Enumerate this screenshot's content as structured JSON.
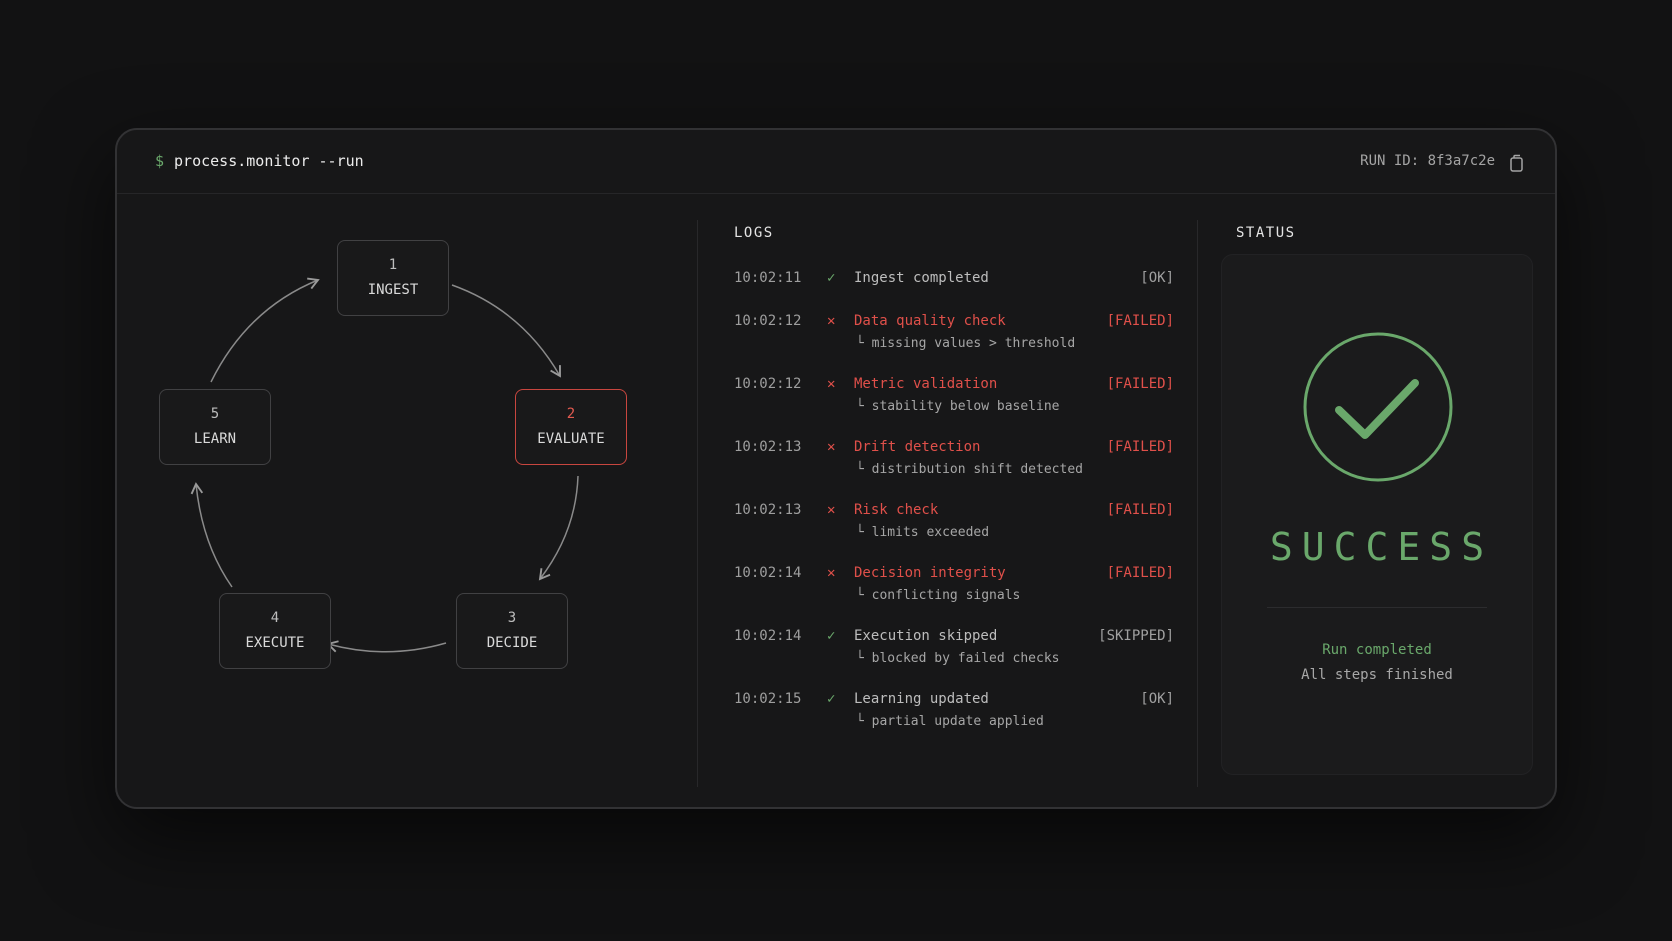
{
  "header": {
    "prompt_symbol": "$",
    "command": "process.monitor --run",
    "run_id": "RUN ID: 8f3a7c2e",
    "copy_icon": "copy-icon"
  },
  "flow": {
    "steps": [
      {
        "number": "1",
        "label": "INGEST",
        "active": false
      },
      {
        "number": "2",
        "label": "EVALUATE",
        "active": true
      },
      {
        "number": "3",
        "label": "DECIDE",
        "active": false
      },
      {
        "number": "4",
        "label": "EXECUTE",
        "active": false
      },
      {
        "number": "5",
        "label": "LEARN",
        "active": false
      }
    ]
  },
  "logs": {
    "title": "LOGS",
    "entries": [
      {
        "time": "10:02:11",
        "status": "ok",
        "icon": "check-icon",
        "message": "Ingest completed",
        "tag": "[OK]",
        "detail": ""
      },
      {
        "time": "10:02:12",
        "status": "fail",
        "icon": "x-icon",
        "message": "Data quality check",
        "tag": "[FAILED]",
        "detail": "└ missing values > threshold"
      },
      {
        "time": "10:02:12",
        "status": "fail",
        "icon": "x-icon",
        "message": "Metric validation",
        "tag": "[FAILED]",
        "detail": "└ stability below baseline"
      },
      {
        "time": "10:02:13",
        "status": "fail",
        "icon": "x-icon",
        "message": "Drift detection",
        "tag": "[FAILED]",
        "detail": "└ distribution shift detected"
      },
      {
        "time": "10:02:13",
        "status": "fail",
        "icon": "x-icon",
        "message": "Risk check",
        "tag": "[FAILED]",
        "detail": "└ limits exceeded"
      },
      {
        "time": "10:02:14",
        "status": "fail",
        "icon": "x-icon",
        "message": "Decision integrity",
        "tag": "[FAILED]",
        "detail": "└ conflicting signals"
      },
      {
        "time": "10:02:14",
        "status": "ok",
        "icon": "check-icon",
        "message": "Execution skipped",
        "tag": "[SKIPPED]",
        "detail": "└ blocked by failed checks"
      },
      {
        "time": "10:02:15",
        "status": "ok",
        "icon": "check-icon",
        "message": "Learning updated",
        "tag": "[OK]",
        "detail": "└ partial update applied"
      }
    ]
  },
  "status": {
    "title": "STATUS",
    "result": "SUCCESS",
    "icon": "success-check-icon",
    "line1": "Run completed",
    "line2": "All steps finished"
  },
  "colors": {
    "accent_green": "#6aa86b",
    "accent_red": "#e0504a",
    "background": "#121213",
    "panel": "#171718"
  }
}
